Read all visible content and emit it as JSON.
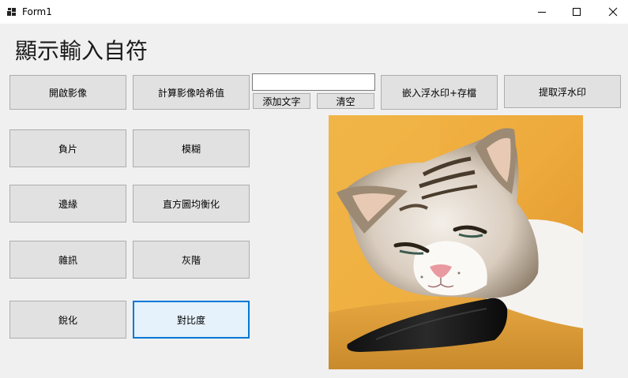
{
  "window": {
    "title": "Form1"
  },
  "heading": "顯示輸入自符",
  "buttons": {
    "open_image": "開啟影像",
    "compute_hash": "計算影像哈希值",
    "add_text": "添加文字",
    "clear": "清空",
    "embed_watermark": "嵌入浮水印+存檔",
    "extract_watermark": "提取浮水印",
    "negative": "負片",
    "blur": "模糊",
    "edge": "邊緣",
    "histogram_equalization": "直方圖均衡化",
    "noise": "雜訊",
    "grayscale": "灰階",
    "sharpen": "銳化",
    "contrast": "對比度"
  },
  "text_input": {
    "value": ""
  },
  "icons": {
    "app": "app-window-icon",
    "minimize": "minimize-icon",
    "maximize": "maximize-icon",
    "close": "close-icon"
  },
  "colors": {
    "focus_border": "#0078d7",
    "button_face": "#e1e1e1",
    "form_background": "#f0f0f0"
  }
}
